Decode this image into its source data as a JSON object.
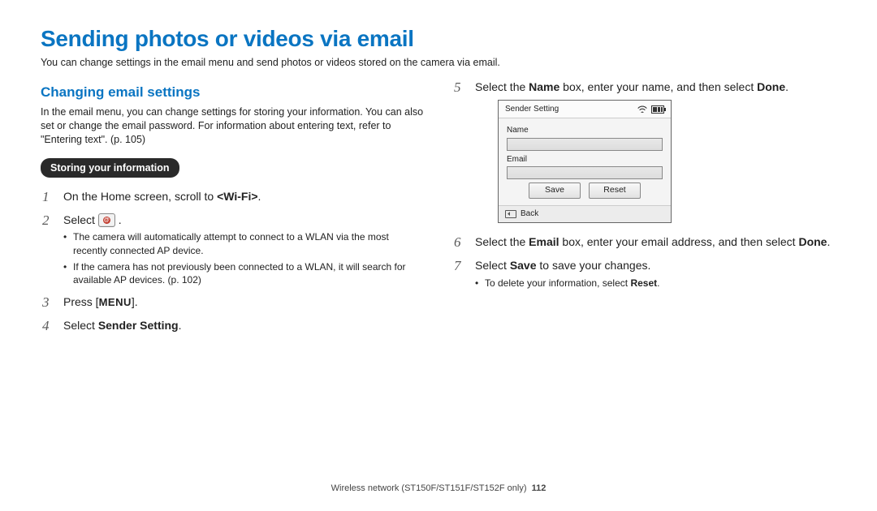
{
  "title": "Sending photos or videos via email",
  "intro": "You can change settings in the email menu and send photos or videos stored on the camera via email.",
  "subheading": "Changing email settings",
  "subintro": "In the email menu, you can change settings for storing your information. You can also set or change the email password. For information about entering text, refer to \"Entering text\". (p. 105)",
  "pill": "Storing your information",
  "steps_left": {
    "s1": {
      "num": "1",
      "pre": "On the Home screen, scroll to ",
      "bold": "<Wi-Fi>",
      "post": "."
    },
    "s2": {
      "num": "2",
      "pre": "Select ",
      "post": " .",
      "sub1": "The camera will automatically attempt to connect to a WLAN via the most recently connected AP device.",
      "sub2": "If the camera has not previously been connected to a WLAN, it will search for available AP devices. (p. 102)"
    },
    "s3": {
      "num": "3",
      "pre": "Press [",
      "key": "MENU",
      "post": "]."
    },
    "s4": {
      "num": "4",
      "pre": "Select ",
      "bold": "Sender Setting",
      "post": "."
    }
  },
  "steps_right": {
    "s5": {
      "num": "5",
      "pre": "Select the ",
      "b1": "Name",
      "mid": " box, enter your name, and then select ",
      "b2": "Done",
      "post": "."
    },
    "s6": {
      "num": "6",
      "pre": "Select the ",
      "b1": "Email",
      "mid": " box, enter your email address, and then select ",
      "b2": "Done",
      "post": "."
    },
    "s7": {
      "num": "7",
      "pre": "Select ",
      "b1": "Save",
      "post": " to save your changes.",
      "sub1a": "To delete your information, select ",
      "sub1b": "Reset",
      "sub1c": "."
    }
  },
  "panel": {
    "header": "Sender Setting",
    "name_label": "Name",
    "email_label": "Email",
    "save": "Save",
    "reset": "Reset",
    "back": "Back"
  },
  "footer": {
    "text": "Wireless network  (ST150F/ST151F/ST152F only)",
    "page": "112"
  }
}
